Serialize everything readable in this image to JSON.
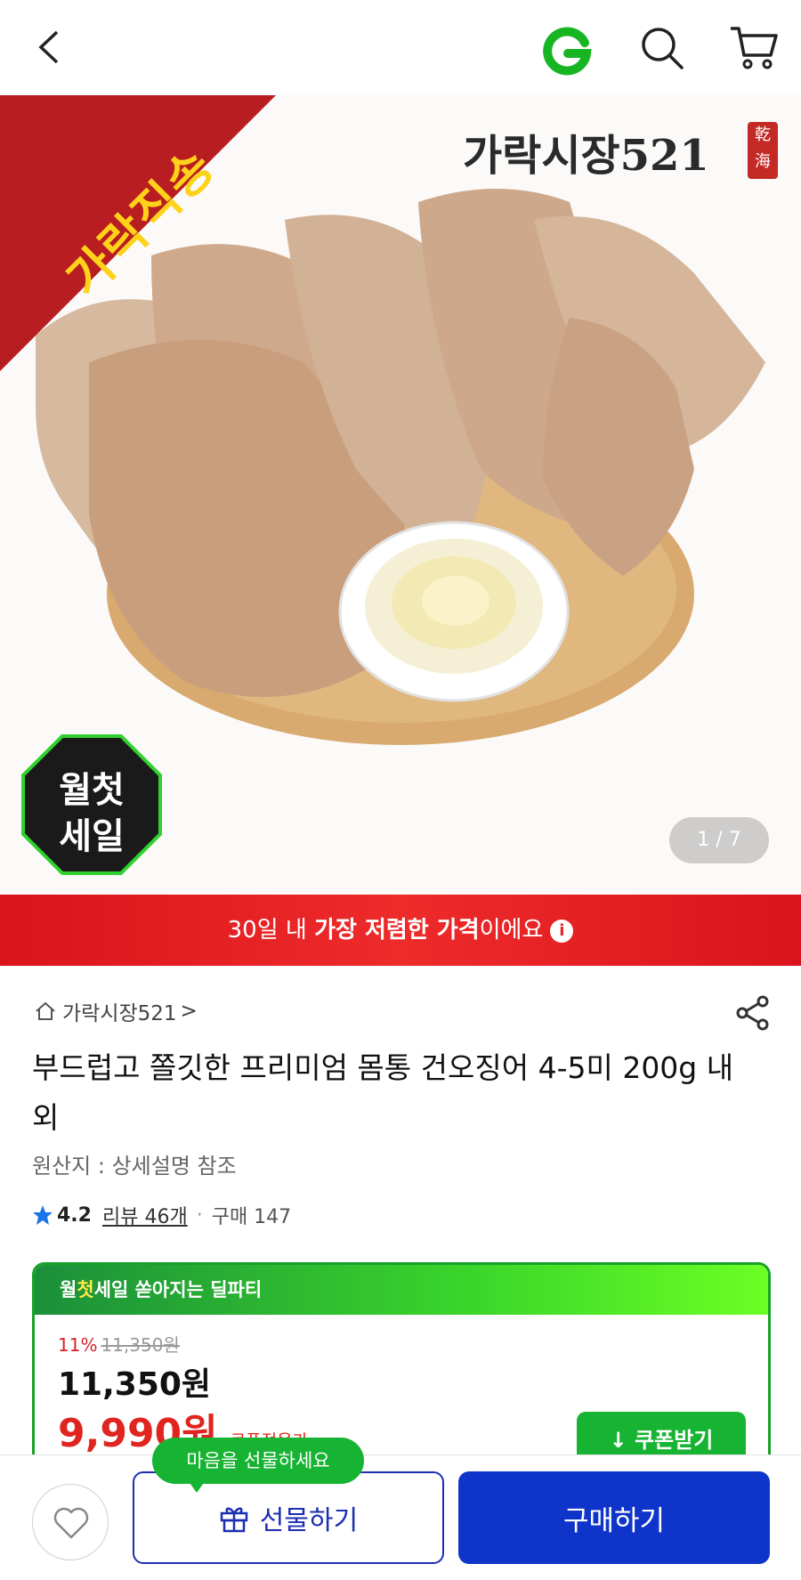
{
  "topbar": {
    "back_icon": "chevron-left-icon",
    "logo_icon": "g-logo-icon",
    "search_icon": "search-icon",
    "cart_icon": "cart-icon"
  },
  "hero": {
    "ribbon_text": "가락직송",
    "brand_title": "가락시장521",
    "brand_seal": "乾海",
    "sale_badge_line1": "월첫",
    "sale_badge_line2": "세일",
    "pager": "1 / 7"
  },
  "lowprice_banner": {
    "prefix": "30일 내 ",
    "bold": "가장 저렴한 가격",
    "suffix": "이에요",
    "info_icon": "i"
  },
  "store": {
    "name": "가락시장521",
    "chevron": ">"
  },
  "product": {
    "title": "부드럽고 쫄깃한 프리미엄 몸통 건오징어 4-5미 200g 내외",
    "origin": "원산지 : 상세설명 참조"
  },
  "rating": {
    "score": "4.2",
    "reviews": "리뷰 46개",
    "separator": "·",
    "purchases": "구매 147"
  },
  "deal": {
    "head_a": "월",
    "head_b": "첫",
    "head_c": "세일 쏟아지는 딜파티",
    "discount": "11%",
    "original_price": "11,350원",
    "price": "11,350원",
    "coupon_price": "9,990원",
    "coupon_note": "쿠폰적용가",
    "coupon_button": "쿠폰받기"
  },
  "bottom": {
    "tooltip": "마음을 선물하세요",
    "gift_label": "선물하기",
    "buy_label": "구매하기"
  },
  "colors": {
    "primary_blue": "#0f34c9",
    "sale_red": "#e0241f",
    "deal_green": "#17b332"
  }
}
